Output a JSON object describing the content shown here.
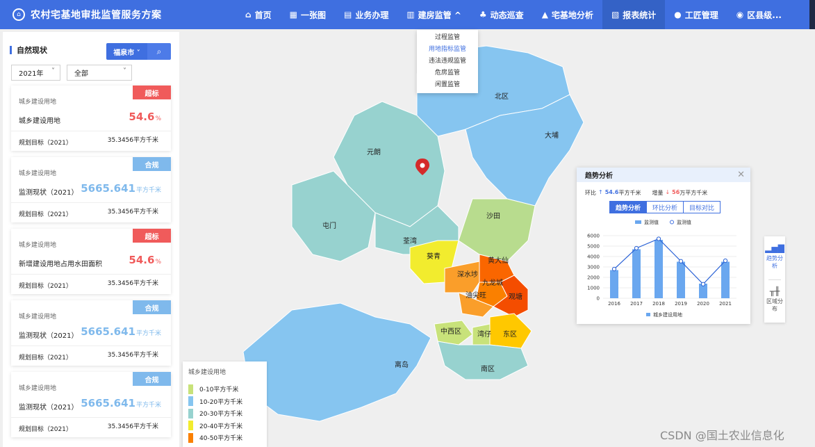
{
  "app": {
    "title": "农村宅基地审批监管服务方案"
  },
  "nav": [
    {
      "icon": "home-icon",
      "glyph": "⌂",
      "label": "首页"
    },
    {
      "icon": "map-icon",
      "glyph": "▦",
      "label": "一张图"
    },
    {
      "icon": "briefcase-icon",
      "glyph": "▤",
      "label": "业务办理"
    },
    {
      "icon": "building-icon",
      "glyph": "▥",
      "label": "建房监管 ^"
    },
    {
      "icon": "patrol-icon",
      "glyph": "♣",
      "label": "动态巡查"
    },
    {
      "icon": "bank-icon",
      "glyph": "▲",
      "label": "宅基地分析"
    },
    {
      "icon": "report-icon",
      "glyph": "▧",
      "label": "报表统计"
    },
    {
      "icon": "user-icon",
      "glyph": "●",
      "label": "工匠管理"
    },
    {
      "icon": "globe-icon",
      "glyph": "◉",
      "label": "区县级..."
    }
  ],
  "dropdown": [
    "过程监管",
    "用地指标监管",
    "违法违规监管",
    "危房监管",
    "闲置监管"
  ],
  "left": {
    "heading": "自然现状",
    "city": "福泉市 ˅",
    "year": "2021年",
    "scope": "全部",
    "cards": [
      {
        "badge": "超标",
        "badge_color": "red",
        "category": "城乡建设用地",
        "name": "城乡建设用地",
        "value": "54.6",
        "unit": "%",
        "plan_label": "规划目标（2021）",
        "plan_value": "35.3456平方千米"
      },
      {
        "badge": "合规",
        "badge_color": "blue",
        "category": "城乡建设用地",
        "name": "监测现状（2021）",
        "value": "5665.641",
        "unit": "平方千米",
        "plan_label": "规划目标（2021）",
        "plan_value": "35.3456平方千米"
      },
      {
        "badge": "超标",
        "badge_color": "red",
        "category": "城乡建设用地",
        "name": "新增建设用地占用水田面积",
        "value": "54.6",
        "unit": "%",
        "plan_label": "规划目标（2021）",
        "plan_value": "35.3456平方千米"
      },
      {
        "badge": "合规",
        "badge_color": "blue",
        "category": "城乡建设用地",
        "name": "监测现状（2021）",
        "value": "5665.641",
        "unit": "平方千米",
        "plan_label": "规划目标（2021）",
        "plan_value": "35.3456平方千米"
      },
      {
        "badge": "合规",
        "badge_color": "blue",
        "category": "城乡建设用地",
        "name": "监测现状（2021）",
        "value": "5665.641",
        "unit": "平方千米",
        "plan_label": "规划目标（2021）",
        "plan_value": "35.3456平方千米"
      }
    ]
  },
  "map": {
    "labels": [
      "北区",
      "大埔",
      "元朗",
      "屯门",
      "沙田",
      "荃湾",
      "葵青",
      "黄大仙",
      "深水埗",
      "九龙城",
      "油尖旺",
      "观塘",
      "中西区",
      "湾仔",
      "东区",
      "离岛",
      "南区"
    ]
  },
  "legend": {
    "title": "城乡建设用地",
    "items": [
      {
        "label": "0-10平方千米",
        "color": "#c8e27a"
      },
      {
        "label": "10-20平方千米",
        "color": "#86c5f0"
      },
      {
        "label": "20-30平方千米",
        "color": "#97d2cf"
      },
      {
        "label": "20-40平方千米",
        "color": "#f2ec2e"
      },
      {
        "label": "40-50平方千米",
        "color": "#fa8000"
      }
    ]
  },
  "trend": {
    "title": "趋势分析",
    "stat1_label": "环比",
    "stat1_value": "54.6",
    "stat1_unit": "平方千米",
    "stat2_label": "增量",
    "stat2_value": "56",
    "stat2_unit": "万平方千米",
    "tabs": [
      "趋势分析",
      "环比分析",
      "目标对比"
    ],
    "legend_bar": "监测值",
    "legend_line": "监测值",
    "legend_bottom": "城乡建设用地"
  },
  "chart_data": {
    "type": "bar",
    "categories": [
      "2016",
      "2017",
      "2018",
      "2019",
      "2020",
      "2021"
    ],
    "series": [
      {
        "name": "监测值",
        "type": "bar",
        "values": [
          2700,
          4700,
          5600,
          3500,
          1400,
          3500
        ]
      },
      {
        "name": "监测值",
        "type": "line",
        "values": [
          2800,
          4800,
          5700,
          3550,
          1350,
          3600
        ]
      }
    ],
    "yticks": [
      0,
      1000,
      2000,
      3000,
      4000,
      5000,
      6000
    ],
    "ylim": [
      0,
      6000
    ],
    "legend_bottom": "城乡建设用地"
  },
  "side": [
    {
      "icon": "bar-chart-icon",
      "label": "趋势分析"
    },
    {
      "icon": "region-icon",
      "label": "区域分布"
    }
  ],
  "watermark": "CSDN @国土农业信息化",
  "colors": {
    "primary": "#3f6fe0",
    "red": "#f05b5b",
    "blue": "#7fb9ec"
  }
}
